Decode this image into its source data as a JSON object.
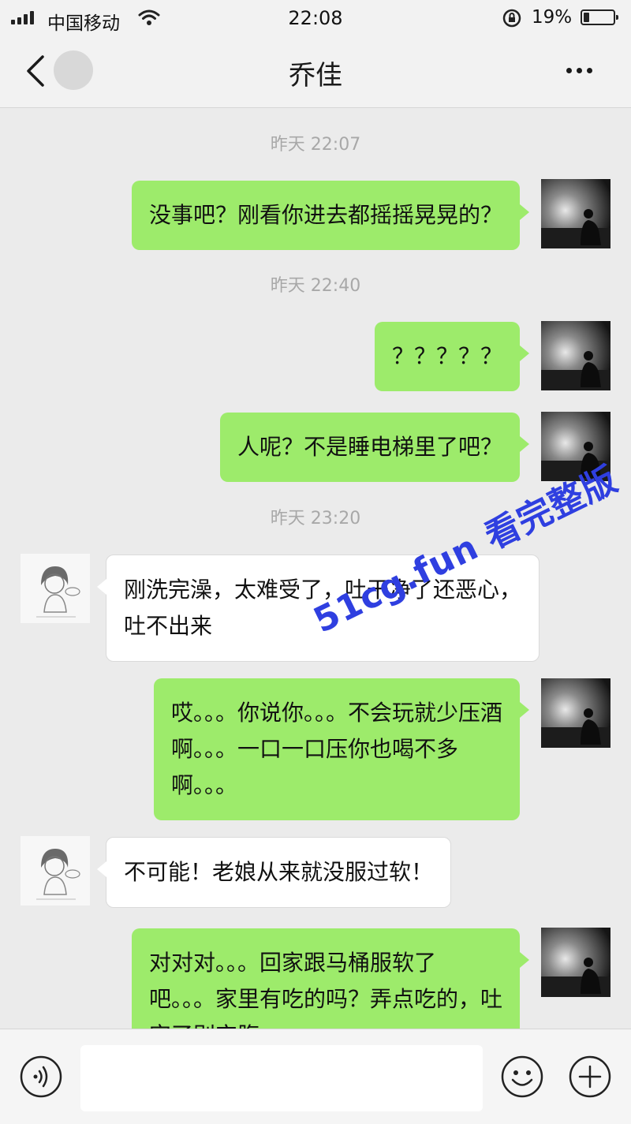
{
  "status_bar": {
    "carrier": "中国移动",
    "time": "22:08",
    "battery_text": "19%",
    "battery_level": 0.19
  },
  "header": {
    "title": "乔佳",
    "back_icon": "chevron-left-icon",
    "more_icon": "more-dots-icon"
  },
  "chat": {
    "timestamps": [
      "昨天 22:07",
      "昨天 22:40",
      "昨天 23:20"
    ],
    "messages": [
      {
        "sender": "me",
        "lines": [
          "没事吧？刚看你进去都摇摇晃晃的？"
        ]
      },
      {
        "sender": "me",
        "lines": [
          "？？？？？"
        ]
      },
      {
        "sender": "me",
        "lines": [
          "人呢？不是睡电梯里了吧？"
        ]
      },
      {
        "sender": "other",
        "lines": [
          "刚洗完澡，太难受了，吐干净了还恶心，",
          "吐不出来"
        ]
      },
      {
        "sender": "me",
        "lines": [
          "哎。。。你说你。。。不会玩就少压酒",
          "啊。。。一口一口压你也喝不多",
          "啊。。。"
        ]
      },
      {
        "sender": "other",
        "lines": [
          "不可能！老娘从来就没服过软！"
        ]
      },
      {
        "sender": "me",
        "lines": [
          "对对对。。。回家跟马桶服软了",
          "吧。。。家里有吃的吗？弄点吃的，吐",
          "完了别空腹"
        ]
      }
    ]
  },
  "watermark": "51cg.fun 看完整版",
  "input_bar": {
    "placeholder": "",
    "voice_icon": "voice-icon",
    "emoji_icon": "emoji-icon",
    "plus_icon": "plus-icon"
  },
  "colors": {
    "outgoing_bubble": "#9deb6b",
    "incoming_bubble": "#ffffff",
    "background": "#ebebeb",
    "watermark": "#2f3fe0"
  }
}
